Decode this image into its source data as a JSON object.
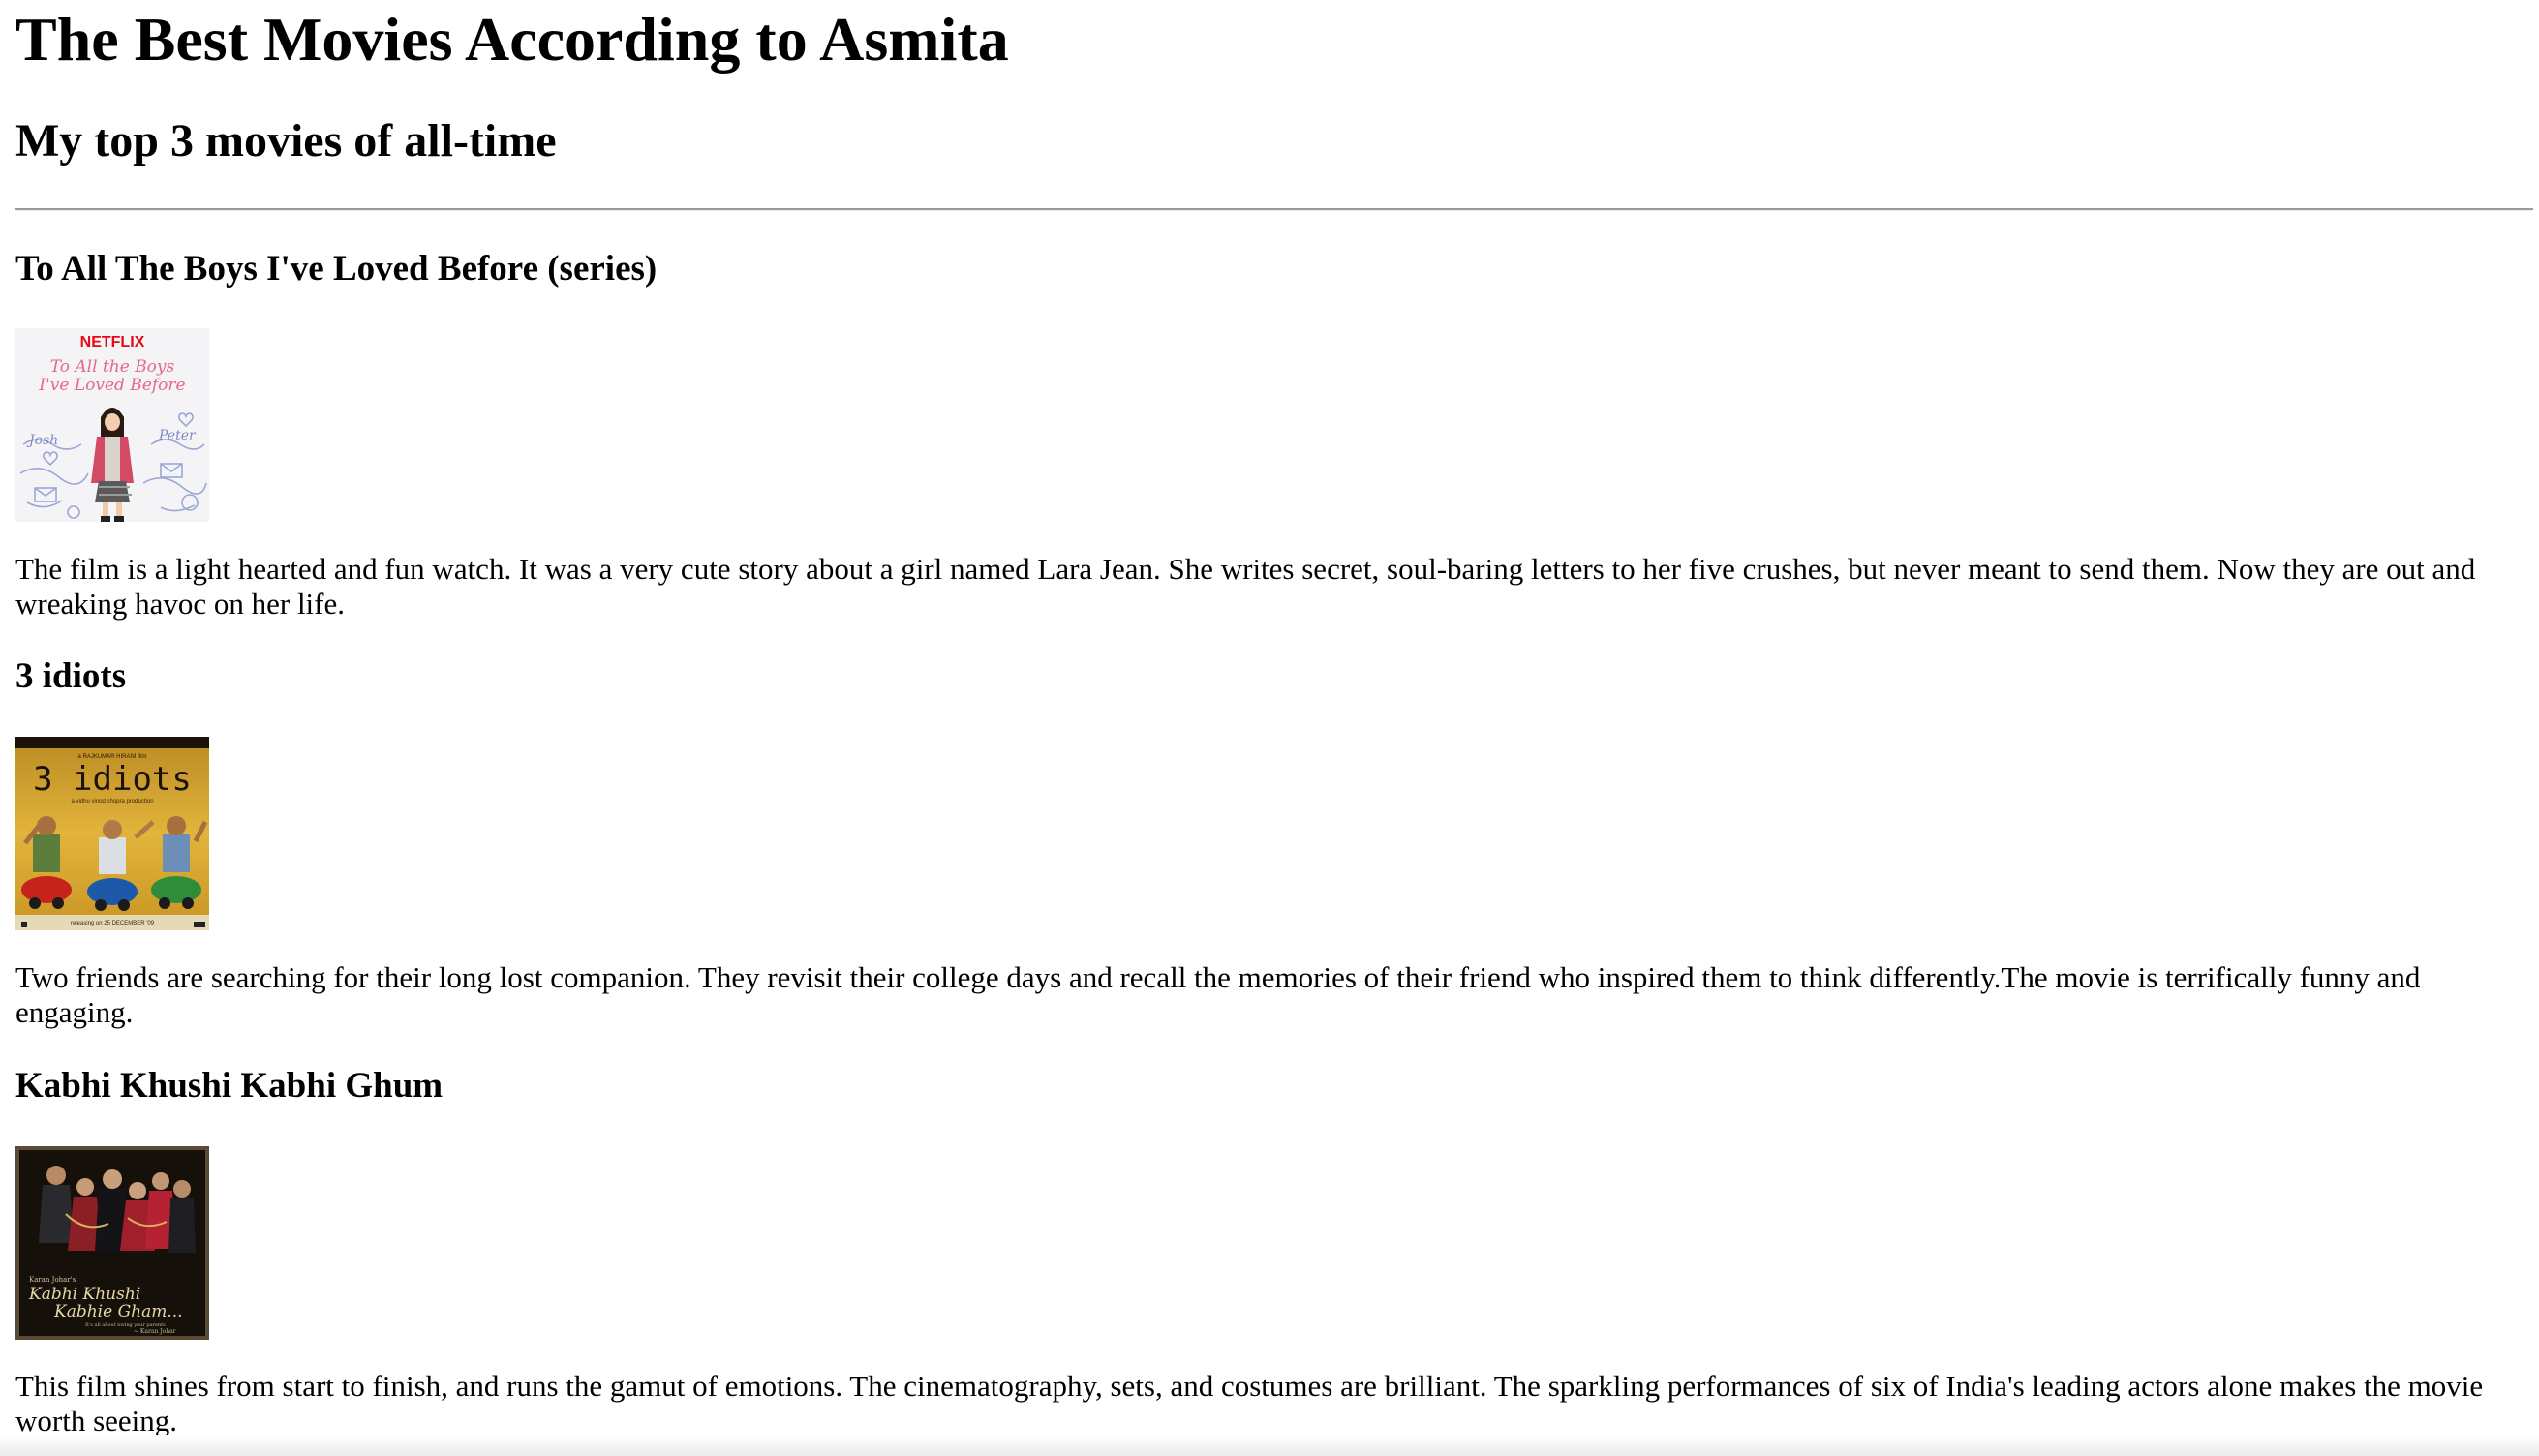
{
  "page": {
    "title": "The Best Movies According to Asmita",
    "subtitle": "My top 3 movies of all-time"
  },
  "movies": [
    {
      "title": "To All The Boys I've Loved Before (series)",
      "poster": {
        "brand": "NETFLIX",
        "title_line1": "To All the Boys",
        "title_line2": "I've Loved Before",
        "name_left": "Josh",
        "name_right": "Peter"
      },
      "description": "The film is a light hearted and fun watch. It was a very cute story about a girl named Lara Jean. She writes secret, soul-baring letters to her five crushes, but never meant to send them. Now they are out and wreaking havoc on her life."
    },
    {
      "title": "3 idiots",
      "poster": {
        "title": "3 idiots",
        "top_credit": "a RAJKUMAR HIRANI film",
        "tagline": "a vidhu vinod chopra production",
        "release": "releasing on 25 DECEMBER '09"
      },
      "description": "Two friends are searching for their long lost companion. They revisit their college days and recall the memories of their friend who inspired them to think differently.The movie is terrifically funny and engaging."
    },
    {
      "title": "Kabhi Khushi Kabhi Ghum",
      "poster": {
        "presenter": "Karan Johar's",
        "title_line1": "Kabhi Khushi",
        "title_line2": "Kabhie Gham...",
        "tagline": "It's all about loving your parents",
        "credit": "~ Karan Johar"
      },
      "description": "This film shines from start to finish, and runs the gamut of emotions. The cinematography, sets, and costumes are brilliant. The sparkling performances of six of India's leading actors alone makes the movie worth seeing."
    }
  ],
  "colors": {
    "text": "#000000",
    "rule": "#9a9a9a",
    "netflix_red": "#e50914",
    "idiots_yellow": "#d9a92a",
    "kkkg_dark": "#1c140c"
  }
}
